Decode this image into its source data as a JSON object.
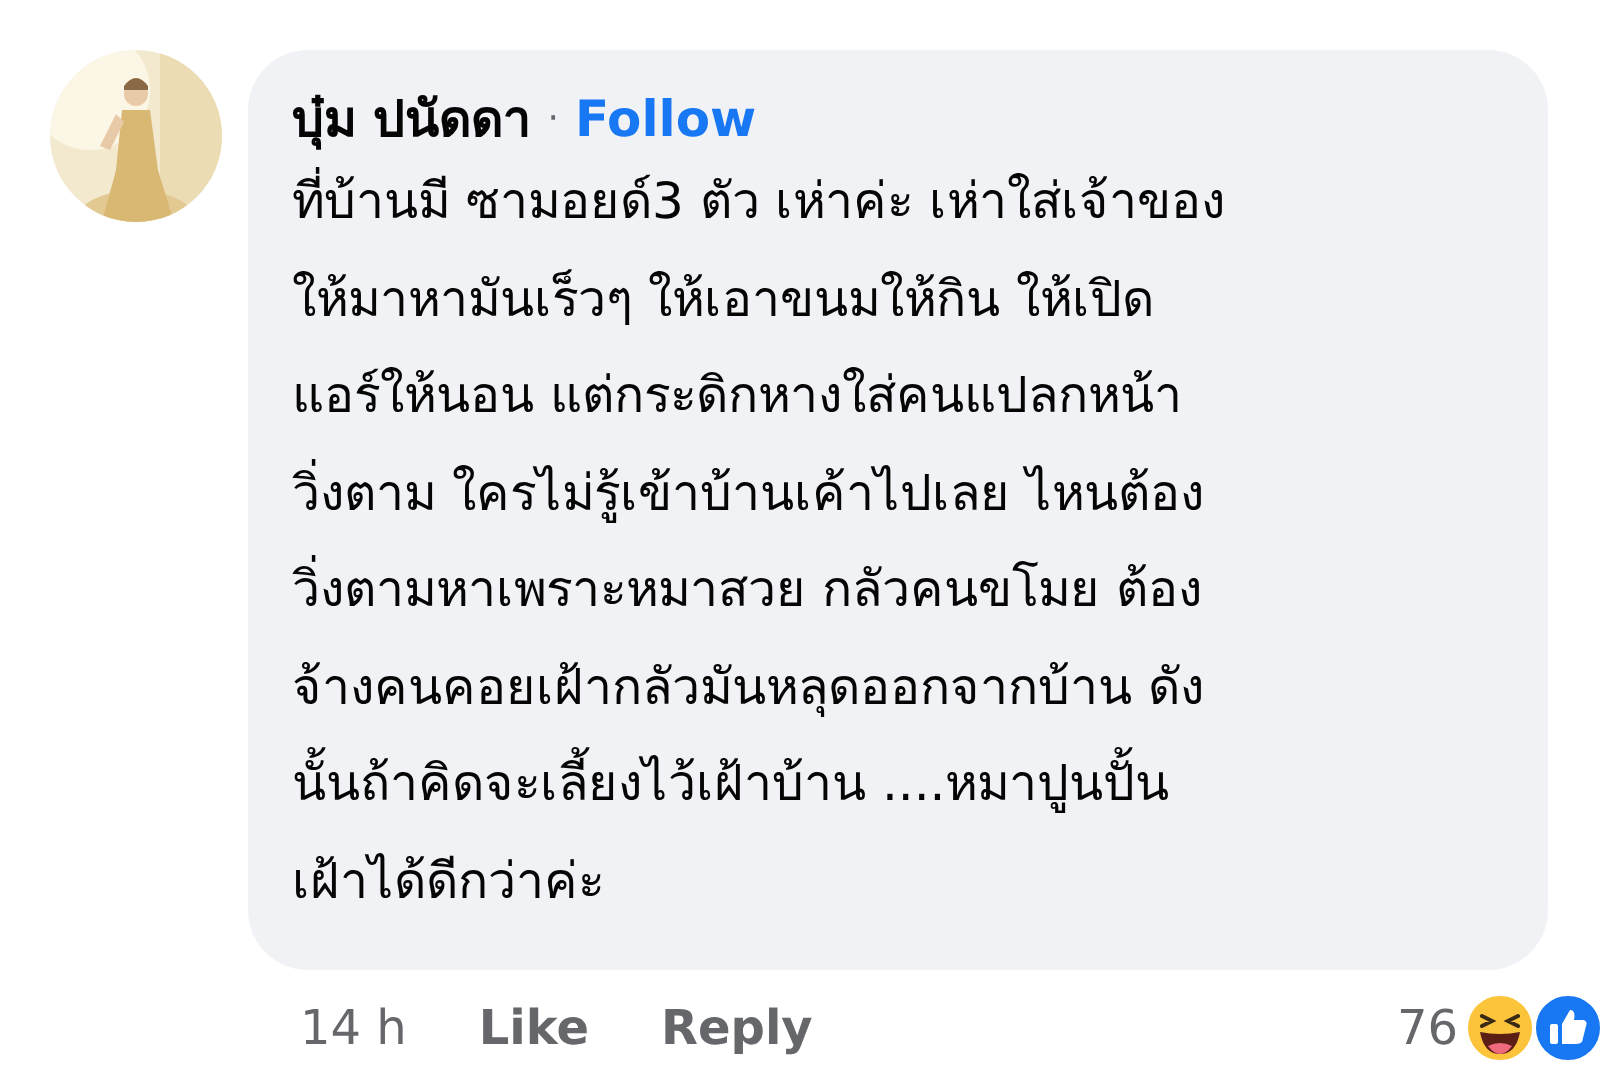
{
  "comment": {
    "author": "บุ๋ม ปนัดดา",
    "separator": "·",
    "follow": "Follow",
    "text": "ที่บ้านมี ซามอยด์3 ตัว เห่าค่ะ เห่าใส่เจ้าของ\nให้มาหามันเร็วๆ ให้เอาขนมให้กิน ให้เปิด\nแอร์ให้นอน แต่กระดิกหางใส่คนแปลกหน้า\nวิ่งตาม ใครไม่รู้เข้าบ้านเค้าไปเลย ไหนต้อง\nวิ่งตามหาเพราะหมาสวย กลัวคนขโมย ต้อง\nจ้างคนคอยเฝ้ากลัวมันหลุดออกจากบ้าน ดัง\nนั้นถ้าคิดจะเลี้ยงไว้เฝ้าบ้าน ....หมาปูนปั้น\nเฝ้าได้ดีกว่าค่ะ",
    "time": "14 h",
    "actions": [
      {
        "label": "Like"
      },
      {
        "label": "Reply"
      }
    ],
    "reaction_count": "76",
    "reactions": [
      {
        "kind": "haha"
      },
      {
        "kind": "like"
      }
    ]
  }
}
